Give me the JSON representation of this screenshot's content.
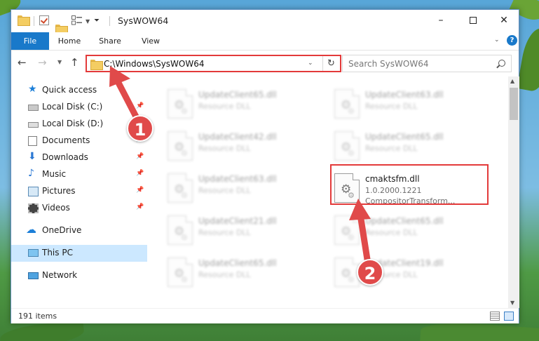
{
  "window": {
    "title": "SysWOW64",
    "controls": {
      "minimize": "–",
      "maximize": "",
      "close": "✕"
    }
  },
  "ribbon": {
    "tabs": [
      "File",
      "Home",
      "Share",
      "View"
    ],
    "expand_icon": "chevron-down-icon",
    "help": "?"
  },
  "toolbar": {
    "address": "C:\\Windows\\SysWOW64",
    "search_placeholder": "Search SysWOW64"
  },
  "sidebar": {
    "items": [
      {
        "label": "Quick access",
        "icon": "star-icon"
      },
      {
        "label": "Local Disk (C:)",
        "icon": "drive-icon",
        "pinned": true
      },
      {
        "label": "Local Disk (D:)",
        "icon": "drive-icon"
      },
      {
        "label": "Documents",
        "icon": "documents-icon",
        "pinned": true
      },
      {
        "label": "Downloads",
        "icon": "download-icon",
        "pinned": true
      },
      {
        "label": "Music",
        "icon": "music-icon",
        "pinned": true
      },
      {
        "label": "Pictures",
        "icon": "pictures-icon",
        "pinned": true
      },
      {
        "label": "Videos",
        "icon": "videos-icon",
        "pinned": true
      },
      {
        "label": "OneDrive",
        "icon": "cloud-icon"
      },
      {
        "label": "This PC",
        "icon": "pc-icon",
        "selected": true
      },
      {
        "label": "Network",
        "icon": "network-icon"
      }
    ]
  },
  "files": [
    {
      "name": "UpdateClient65.dll",
      "type": "Resource DLL",
      "blurred": true
    },
    {
      "name": "UpdateClient63.dll",
      "type": "Resource DLL",
      "blurred": true
    },
    {
      "name": "UpdateClient42.dll",
      "type": "Resource DLL",
      "blurred": true
    },
    {
      "name": "UpdateClient65.dll",
      "type": "Resource DLL",
      "blurred": true
    },
    {
      "name": "UpdateClient63.dll",
      "type": "Resource DLL",
      "blurred": true
    },
    {
      "name": "cmaktsfm.dll",
      "version": "1.0.2000.1221",
      "description": "CompositorTransform...",
      "blurred": false
    },
    {
      "name": "UpdateClient21.dll",
      "type": "Resource DLL",
      "blurred": true
    },
    {
      "name": "UpdateClient65.dll",
      "type": "Resource DLL",
      "blurred": true
    },
    {
      "name": "UpdateClient65.dll",
      "type": "Resource DLL",
      "blurred": true
    },
    {
      "name": "UpdateClient19.dll",
      "type": "Resource DLL",
      "blurred": true
    }
  ],
  "status": {
    "item_count": "191 items"
  },
  "annotations": {
    "step1": "1",
    "step2": "2",
    "color": "#e04a4a"
  },
  "colors": {
    "accent": "#1979ca",
    "highlight_border": "#e33a3a",
    "selected_bg": "#cce8ff"
  }
}
